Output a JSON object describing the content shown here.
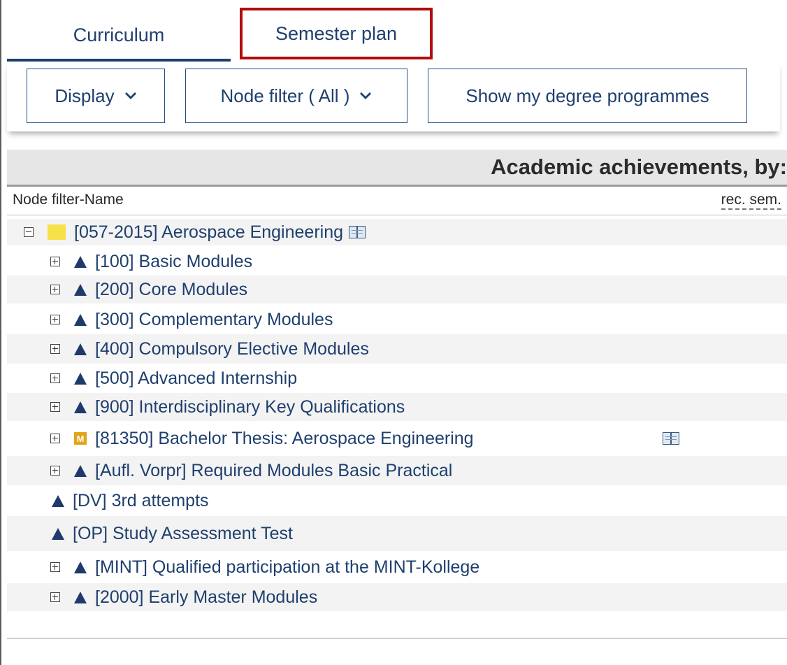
{
  "tabs": {
    "curriculum": "Curriculum",
    "semester_plan": "Semester plan"
  },
  "toolbar": {
    "display": "Display",
    "node_filter": "Node filter ( All )",
    "show_programmes": "Show my degree programmes"
  },
  "section": {
    "title": "Academic achievements, by:"
  },
  "columns": {
    "name": "Node filter-Name",
    "rec_sem": "rec. sem."
  },
  "tree": {
    "root": {
      "label": "[057-2015] Aerospace Engineering",
      "icon": "folder-icon"
    },
    "items": [
      {
        "label": "[100] Basic Modules",
        "icon": "triangle-icon",
        "expander": "plus"
      },
      {
        "label": "[200] Core Modules",
        "icon": "triangle-icon",
        "expander": "plus"
      },
      {
        "label": "[300] Complementary Modules",
        "icon": "triangle-icon",
        "expander": "plus"
      },
      {
        "label": "[400] Compulsory Elective Modules",
        "icon": "triangle-icon",
        "expander": "plus"
      },
      {
        "label": "[500] Advanced Internship",
        "icon": "triangle-icon",
        "expander": "plus"
      },
      {
        "label": "[900] Interdisciplinary Key Qualifications",
        "icon": "triangle-icon",
        "expander": "plus"
      },
      {
        "label": "[81350] Bachelor Thesis: Aerospace Engineering",
        "icon": "module-m-icon",
        "badge": "M",
        "expander": "plus"
      },
      {
        "label": "[Aufl. Vorpr] Required Modules Basic Practical",
        "icon": "triangle-icon",
        "expander": "plus"
      },
      {
        "label": "[DV] 3rd attempts",
        "icon": "triangle-icon",
        "expander": "none"
      },
      {
        "label": "[OP] Study Assessment Test",
        "icon": "triangle-icon",
        "expander": "none"
      },
      {
        "label": "[MINT] Qualified participation at the MINT-Kollege",
        "icon": "triangle-icon",
        "expander": "plus"
      },
      {
        "label": "[2000] Early Master Modules",
        "icon": "triangle-icon",
        "expander": "plus"
      }
    ]
  },
  "colors": {
    "link_text": "#1f3f6e",
    "highlight_border": "#b30b0b",
    "folder": "#f7e14a",
    "module_badge": "#e2a51a"
  }
}
